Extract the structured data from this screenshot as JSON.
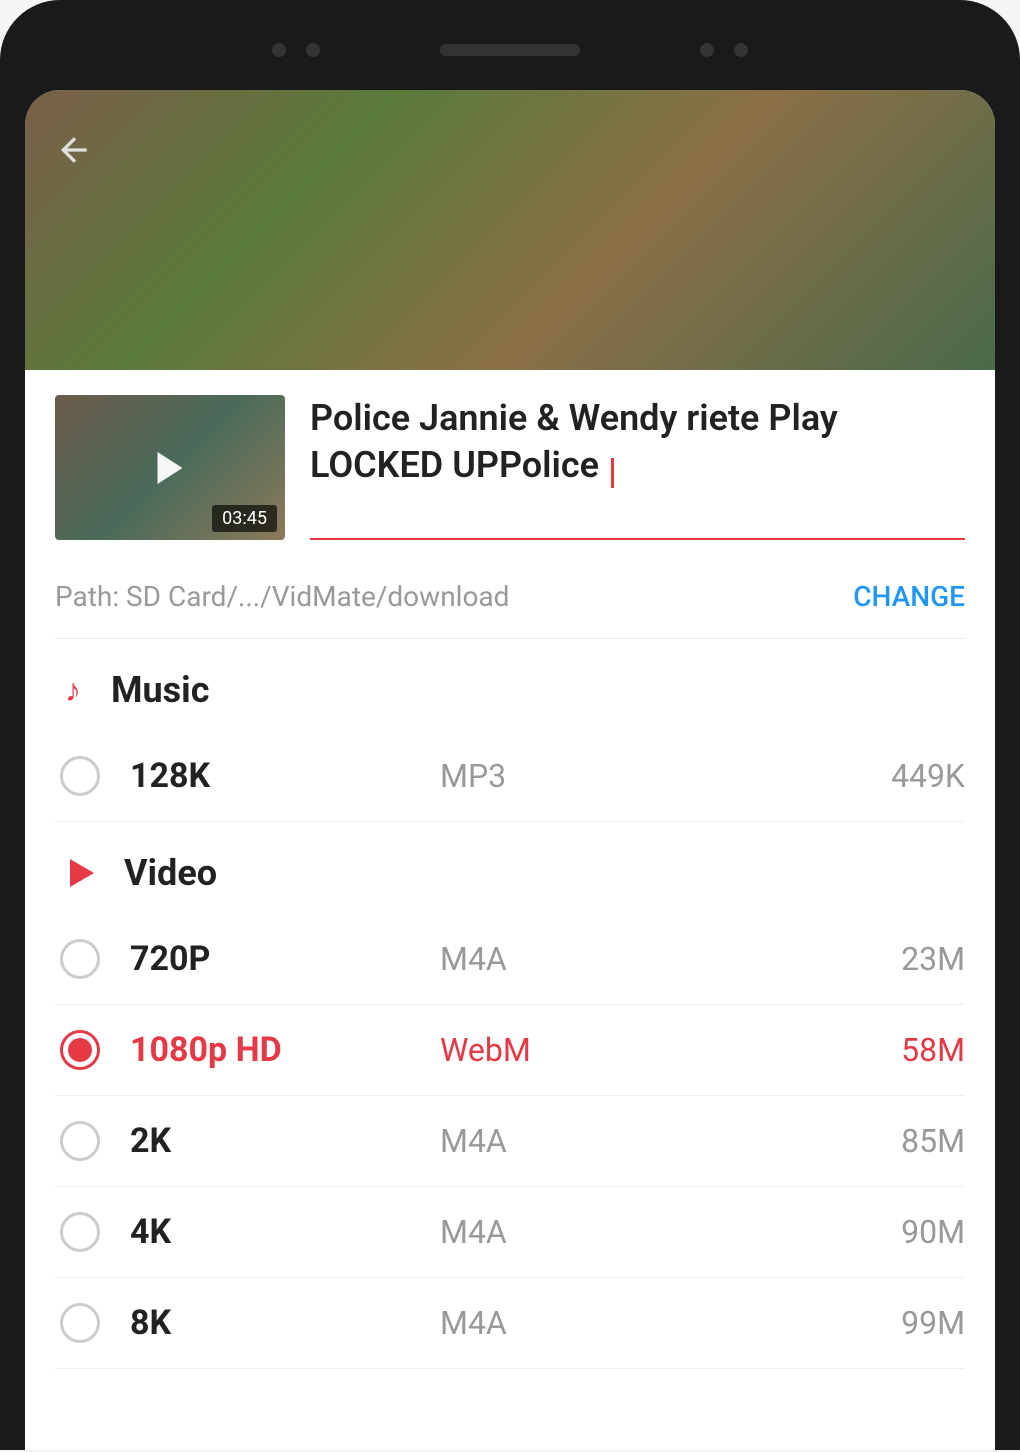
{
  "video": {
    "title": "Police Jannie & Wendy riete Play LOCKED UPPolice",
    "duration": "03:45"
  },
  "path": {
    "label": "Path: SD Card/.../VidMate/download",
    "change_label": "CHANGE"
  },
  "sections": {
    "music": {
      "title": "Music",
      "options": [
        {
          "quality": "128K",
          "format": "MP3",
          "size": "449K",
          "selected": false
        }
      ]
    },
    "video": {
      "title": "Video",
      "options": [
        {
          "quality": "720P",
          "format": "M4A",
          "size": "23M",
          "selected": false
        },
        {
          "quality": "1080p HD",
          "format": "WebM",
          "size": "58M",
          "selected": true
        },
        {
          "quality": "2K",
          "format": "M4A",
          "size": "85M",
          "selected": false
        },
        {
          "quality": "4K",
          "format": "M4A",
          "size": "90M",
          "selected": false
        },
        {
          "quality": "8K",
          "format": "M4A",
          "size": "99M",
          "selected": false
        }
      ]
    }
  }
}
